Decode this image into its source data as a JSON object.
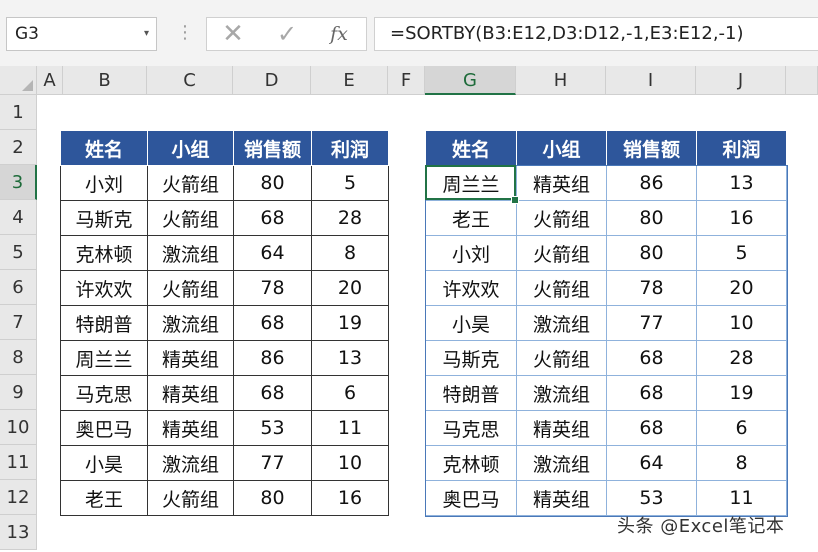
{
  "formula_bar": {
    "name_box": "G3",
    "cancel_glyph": "✕",
    "enter_glyph": "✓",
    "fx_label": "fx",
    "formula": "=SORTBY(B3:E12,D3:D12,-1,E3:E12,-1)"
  },
  "columns": [
    "A",
    "B",
    "C",
    "D",
    "E",
    "F",
    "G",
    "H",
    "I",
    "J"
  ],
  "rows": [
    "1",
    "2",
    "3",
    "4",
    "5",
    "6",
    "7",
    "8",
    "9",
    "10",
    "11",
    "12",
    "13"
  ],
  "selected": {
    "column": "G",
    "row": "3"
  },
  "header_color": "#2e569b",
  "selection_color": "#217346",
  "source_table": {
    "headers": [
      "姓名",
      "小组",
      "销售额",
      "利润"
    ],
    "rows": [
      [
        "小刘",
        "火箭组",
        "80",
        "5"
      ],
      [
        "马斯克",
        "火箭组",
        "68",
        "28"
      ],
      [
        "克林顿",
        "激流组",
        "64",
        "8"
      ],
      [
        "许欢欢",
        "火箭组",
        "78",
        "20"
      ],
      [
        "特朗普",
        "激流组",
        "68",
        "19"
      ],
      [
        "周兰兰",
        "精英组",
        "86",
        "13"
      ],
      [
        "马克思",
        "精英组",
        "68",
        "6"
      ],
      [
        "奥巴马",
        "精英组",
        "53",
        "11"
      ],
      [
        "小昊",
        "激流组",
        "77",
        "10"
      ],
      [
        "老王",
        "火箭组",
        "80",
        "16"
      ]
    ]
  },
  "result_table": {
    "headers": [
      "姓名",
      "小组",
      "销售额",
      "利润"
    ],
    "rows": [
      [
        "周兰兰",
        "精英组",
        "86",
        "13"
      ],
      [
        "老王",
        "火箭组",
        "80",
        "16"
      ],
      [
        "小刘",
        "火箭组",
        "80",
        "5"
      ],
      [
        "许欢欢",
        "火箭组",
        "78",
        "20"
      ],
      [
        "小昊",
        "激流组",
        "77",
        "10"
      ],
      [
        "马斯克",
        "火箭组",
        "68",
        "28"
      ],
      [
        "特朗普",
        "激流组",
        "68",
        "19"
      ],
      [
        "马克思",
        "精英组",
        "68",
        "6"
      ],
      [
        "克林顿",
        "激流组",
        "64",
        "8"
      ],
      [
        "奥巴马",
        "精英组",
        "53",
        "11"
      ]
    ]
  },
  "watermark": "头条 @Excel笔记本"
}
